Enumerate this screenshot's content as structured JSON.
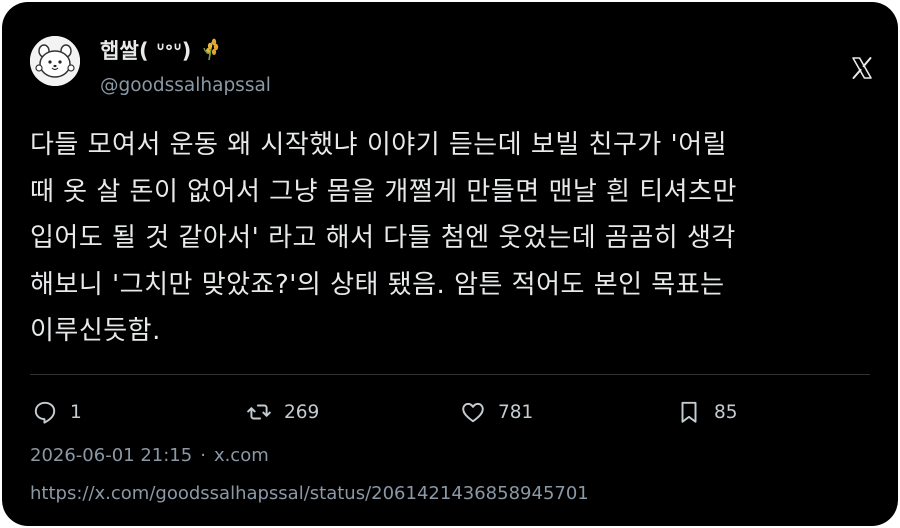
{
  "author": {
    "display_name": "햅쌀( ᐡᐤᐡ)",
    "name_emoji": "wheat-emoji",
    "handle": "@goodssalhapssal",
    "avatar": "cartoon-dog-avatar"
  },
  "brand": {
    "logo": "x-logo-icon"
  },
  "tweet": {
    "text": "다들 모여서 운동 왜 시작했냐 이야기 듣는데 보빌 친구가 '어릴\n때 옷 살 돈이 없어서 그냥 몸을 개쩔게 만들면 맨날 흰 티셔츠만\n입어도 될 것 같아서' 라고 해서 다들 첨엔 웃었는데 곰곰히 생각\n해보니 '그치만 맞았죠?'의 상태 됐음. 암튼 적어도 본인 목표는\n이루신듯함."
  },
  "actions": {
    "replies": {
      "icon": "reply-icon",
      "count": "1"
    },
    "reposts": {
      "icon": "repost-icon",
      "count": "269"
    },
    "likes": {
      "icon": "heart-icon",
      "count": "781"
    },
    "bookmarks": {
      "icon": "bookmark-icon",
      "count": "85"
    }
  },
  "meta": {
    "timestamp": "2026-06-01 21:15",
    "separator": "·",
    "source": "x.com"
  },
  "status_url": "https://x.com/goodssalhapssal/status/2061421436858945701",
  "colors": {
    "background": "#000000",
    "text_primary": "#e7e9ea",
    "text_secondary": "#8b98a5",
    "divider": "#2f3336"
  }
}
